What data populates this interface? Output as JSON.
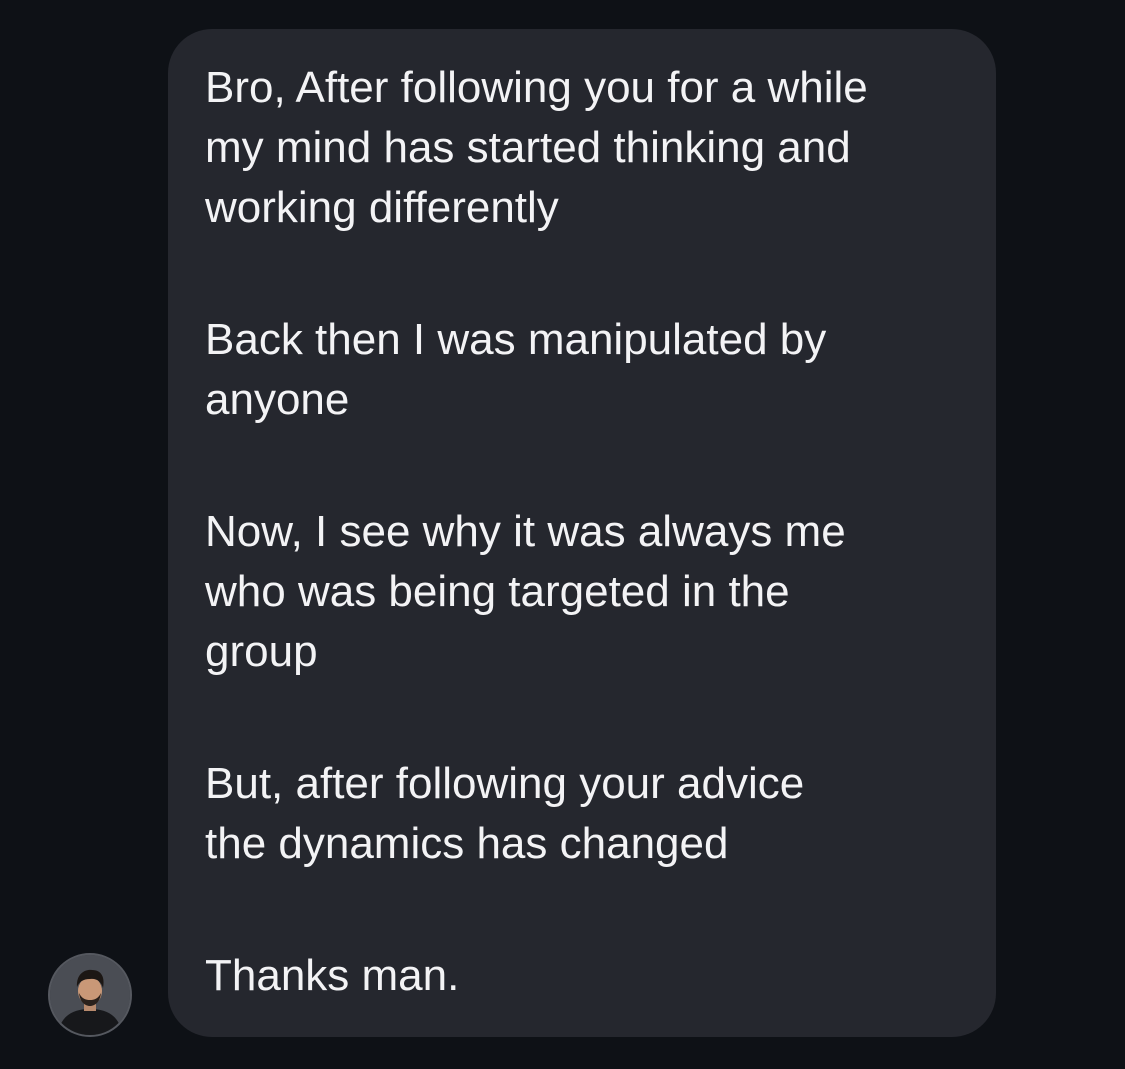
{
  "message": {
    "paragraphs": [
      {
        "lines": [
          "Bro, After following you for a while",
          "my mind has started thinking and",
          "working differently"
        ]
      },
      {
        "lines": [
          "Back then I was manipulated by",
          "anyone"
        ]
      },
      {
        "lines": [
          "Now, I see why it was always me",
          "who was being targeted in the",
          "group"
        ]
      },
      {
        "lines": [
          "But, after following your advice",
          "the dynamics has changed"
        ]
      },
      {
        "lines": [
          "Thanks man."
        ]
      }
    ]
  },
  "sender": {
    "avatar_icon": "person-avatar-icon"
  },
  "colors": {
    "background": "#0e1116",
    "bubble": "#25272e",
    "text": "#f3f3f5"
  }
}
